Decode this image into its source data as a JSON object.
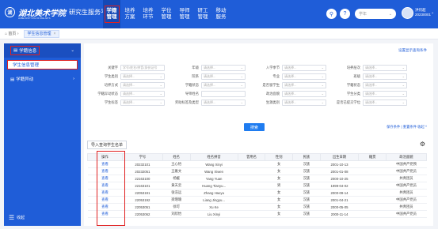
{
  "header": {
    "logo_text": "湖",
    "school_name": "湖北美术学院",
    "school_name_en": "HUBEI INSTITUTE OF FINE ARTS",
    "platform": "研究生服务平台",
    "nav": [
      {
        "label1": "学籍",
        "label2": "管理"
      },
      {
        "label1": "培养",
        "label2": "方案"
      },
      {
        "label1": "培养",
        "label2": "环节"
      },
      {
        "label1": "学位",
        "label2": "管理"
      },
      {
        "label1": "导师",
        "label2": "管理"
      },
      {
        "label1": "研工",
        "label2": "管理"
      },
      {
        "label1": "移动",
        "label2": "服务"
      }
    ],
    "year_placeholder": "学年",
    "user_name": "洪何超",
    "user_id": "20230001"
  },
  "tabs": {
    "home": "首页",
    "active": "学生信息管理"
  },
  "sidebar": {
    "group1": "学籍信息",
    "sub1": "学生信息管理",
    "group2": "学籍异动",
    "footer": "收起"
  },
  "main": {
    "saved_link": "设置显示查询条件",
    "search_label": "搜索",
    "query_links": "保存条件 | 重置条件    收起 ^",
    "import_label": "导入查询学生名单",
    "form": [
      [
        {
          "label": "关键字",
          "value": "学号/姓名/拼音/身份证号"
        },
        {
          "label": "年级",
          "value": "请选择..."
        },
        {
          "label": "入学季节",
          "value": "请选择..."
        },
        {
          "label": "培养层次",
          "value": "请选择..."
        }
      ],
      [
        {
          "label": "学生类别",
          "value": "请选择..."
        },
        {
          "label": "院系",
          "value": "请选择..."
        },
        {
          "label": "专业",
          "value": "请选择..."
        },
        {
          "label": "班级",
          "value": "请选择..."
        }
      ],
      [
        {
          "label": "培养方式",
          "value": "请选择..."
        },
        {
          "label": "学籍状态",
          "value": "请选择..."
        },
        {
          "label": "是否留学生",
          "value": "请选择..."
        },
        {
          "label": "学籍状态",
          "value": "请选择..."
        }
      ],
      [
        {
          "label": "学籍异动状态",
          "value": "请选择..."
        },
        {
          "label": "导师姓名",
          "value": ""
        },
        {
          "label": "政治面貌",
          "value": "请选择..."
        },
        {
          "label": "学生分类",
          "value": "请选择..."
        }
      ],
      [
        {
          "label": "学生标签",
          "value": "请选择..."
        },
        {
          "label": "奖助标签及类型",
          "value": "请选择..."
        },
        {
          "label": "生源类别",
          "value": "请选择..."
        },
        {
          "label": "是否已提交学位",
          "value": "请选择..."
        }
      ]
    ],
    "table": {
      "headers": [
        "操作",
        "学号",
        "姓名",
        "姓名拼音",
        "曾用名",
        "性别",
        "民族",
        "出生日期",
        "籍贯",
        "政治面貌"
      ],
      "rows": [
        [
          "查看",
          "20232101",
          "王心怡",
          "Wang Xinyi",
          "",
          "女",
          "汉族",
          "2001-10-13",
          "",
          "中国共产党预"
        ],
        [
          "查看",
          "20232051",
          "王雅文",
          "Wang Xiwen",
          "",
          "女",
          "汉族",
          "2001-01-08",
          "",
          "中国共产党员"
        ],
        [
          "查看",
          "22163100",
          "杨媛",
          "Yang Yuan",
          "",
          "女",
          "汉族",
          "2000-10-25",
          "",
          "共青团员"
        ],
        [
          "查看",
          "22163101",
          "黄天云",
          "Huang Tianyu...",
          "",
          "男",
          "汉族",
          "1999-04-02",
          "",
          "中国共产党员"
        ],
        [
          "查看",
          "22053191",
          "张浩远",
          "Zhang Haoyu",
          "",
          "女",
          "汉族",
          "2000-09-14",
          "",
          "共青团员"
        ],
        [
          "查看",
          "22053192",
          "梁瑾瑜",
          "Liang Jingyu...",
          "",
          "女",
          "汉族",
          "2001-04-21",
          "",
          "中国共产党员"
        ],
        [
          "查看",
          "22053051",
          "徐可",
          "Xu Ke",
          "",
          "女",
          "汉族",
          "2000-05-05",
          "",
          "共青团员"
        ],
        [
          "查看",
          "22053062",
          "刘欣怡",
          "Liu Xinyi",
          "",
          "女",
          "汉族",
          "2000-11-14",
          "",
          "中国共产党员"
        ]
      ]
    }
  }
}
